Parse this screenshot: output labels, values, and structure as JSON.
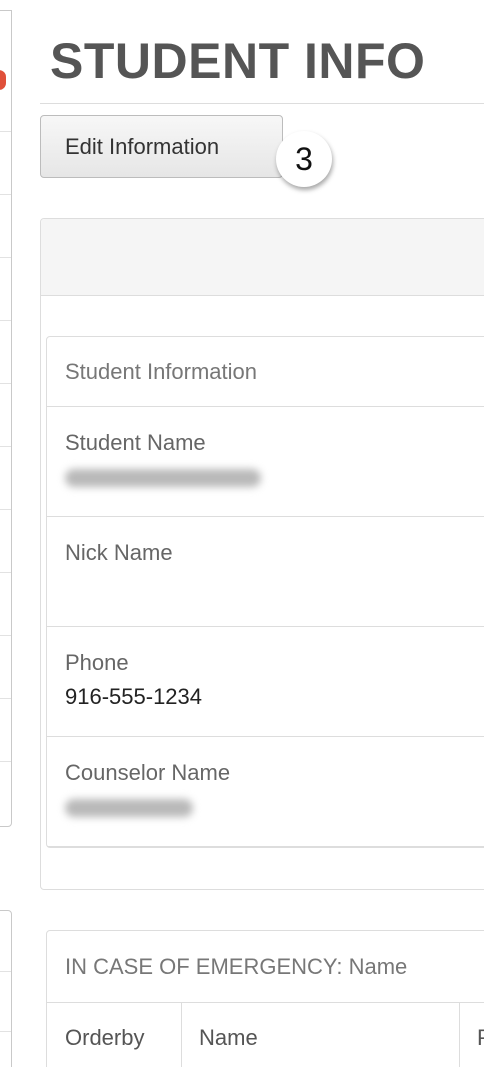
{
  "header": {
    "title": "STUDENT INFO"
  },
  "toolbar": {
    "edit_label": "Edit Information",
    "step_badge": "3"
  },
  "student_panel": {
    "heading": "Student Information",
    "fields": [
      {
        "label": "Student Name",
        "value": ""
      },
      {
        "label": "Nick Name",
        "value": ""
      },
      {
        "label": "Phone",
        "value": "916-555-1234"
      },
      {
        "label": "Counselor Name",
        "value": ""
      }
    ]
  },
  "emergency_panel": {
    "heading": "IN CASE OF EMERGENCY: Name",
    "columns": [
      "Orderby",
      "Name",
      "P"
    ]
  },
  "colors": {
    "title": "#555555",
    "border": "#dddddd",
    "panel_heading_bg": "#f5f5f5",
    "alert_dot": "#e0503a"
  }
}
